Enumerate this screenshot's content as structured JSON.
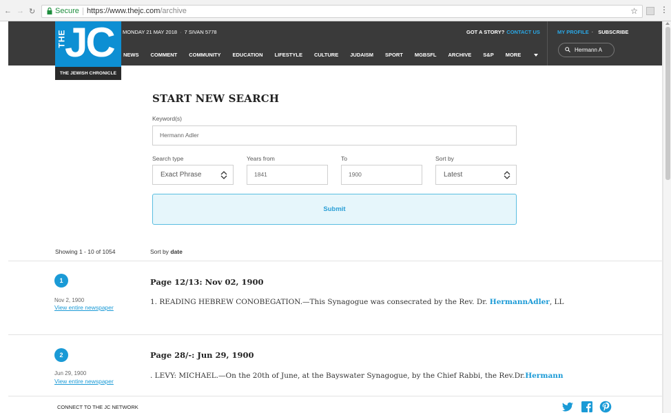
{
  "browser": {
    "secure_label": "Secure",
    "url_host": "https://www.thejc.com",
    "url_path": "/archive",
    "back_icon": "arrow-left-icon",
    "forward_icon": "arrow-right-icon",
    "reload_icon": "reload-icon",
    "star_icon": "star-icon"
  },
  "header": {
    "logo": {
      "the": "THE",
      "jc": "JC",
      "subtitle": "THE JEWISH CHRONICLE"
    },
    "date": "MONDAY 21 MAY 2018",
    "hebrew_date": "7 SIVAN 5778",
    "got_story": "GOT A STORY?",
    "contact": "CONTACT US",
    "my_profile": "MY PROFILE",
    "subscribe": "SUBSCRIBE",
    "search_value": "Hermann A",
    "nav": [
      "NEWS",
      "COMMENT",
      "COMMUNITY",
      "EDUCATION",
      "LIFESTYLE",
      "CULTURE",
      "JUDAISM",
      "SPORT",
      "MGBSFL",
      "ARCHIVE",
      "S&P",
      "MORE"
    ],
    "colors": {
      "bar": "#3a3a3a",
      "logo": "#0d8fd3",
      "accent": "#2aa8e6"
    }
  },
  "search_form": {
    "title": "START NEW SEARCH",
    "keyword_label": "Keyword(s)",
    "keyword_value": "Hermann Adler",
    "search_type_label": "Search type",
    "search_type_value": "Exact Phrase",
    "years_from_label": "Years from",
    "years_from_value": "1841",
    "to_label": "To",
    "to_value": "1900",
    "sort_label": "Sort by",
    "sort_value": "Latest",
    "submit_label": "Submit"
  },
  "results_meta": {
    "showing": "Showing 1 - 10 of 1054",
    "sort_prefix": "Sort by",
    "sort_value": "date"
  },
  "results": [
    {
      "number": "1",
      "title": "Page 12/13: Nov 02, 1900",
      "date": "Nov 2, 1900",
      "link": "View entire newspaper",
      "snippet_before": "1. READING HEBREW CONOBEGATION.—This Synagogue was consecrated by the Rev. Dr. ",
      "snippet_hl": "HermannAdler",
      "snippet_after": ", LL"
    },
    {
      "number": "2",
      "title": "Page 28/-: Jun 29, 1900",
      "date": "Jun 29, 1900",
      "link": "View entire newspaper",
      "snippet_before": ". LEVY: MICHAEL.—On the 20th of June, at the Bayswater Synagogue, by the Chief Rabbi, the Rev.Dr.",
      "snippet_hl": "Hermann",
      "snippet_after": ""
    }
  ],
  "footer": {
    "network_label": "CONNECT TO THE JC NETWORK",
    "social_icons": [
      "twitter-icon",
      "facebook-icon",
      "pinterest-icon"
    ]
  }
}
